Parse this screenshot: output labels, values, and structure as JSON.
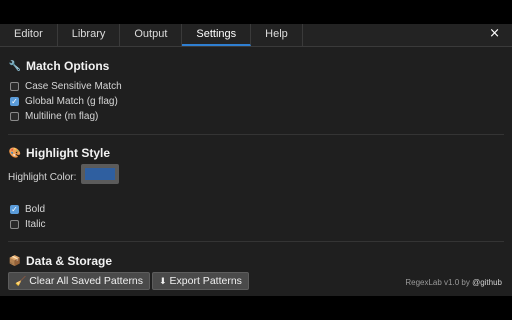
{
  "tabs": [
    {
      "label": "Editor"
    },
    {
      "label": "Library"
    },
    {
      "label": "Output"
    },
    {
      "label": "Settings",
      "active": true
    },
    {
      "label": "Help"
    }
  ],
  "close_symbol": "×",
  "match_options": {
    "title": "Match Options",
    "icon": "wrench-icon",
    "options": [
      {
        "label": "Case Sensitive Match",
        "checked": false
      },
      {
        "label": "Global Match (g flag)",
        "checked": true
      },
      {
        "label": "Multiline (m flag)",
        "checked": false
      }
    ]
  },
  "highlight_style": {
    "title": "Highlight Style",
    "icon": "palette-icon",
    "color_label": "Highlight Color:",
    "color_value": "#2f5fa0",
    "options": [
      {
        "label": "Bold",
        "checked": true
      },
      {
        "label": "Italic",
        "checked": false
      }
    ]
  },
  "data_storage": {
    "title": "Data & Storage",
    "icon": "package-icon",
    "clear_label": "Clear All Saved Patterns",
    "export_label": "Export Patterns"
  },
  "footer": {
    "text": "RegexLab v1.0 by",
    "author": "@github"
  },
  "colors": {
    "accent": "#2f7fd1",
    "background": "#1f1f1f",
    "checkbox_checked": "#5a9bd9"
  }
}
